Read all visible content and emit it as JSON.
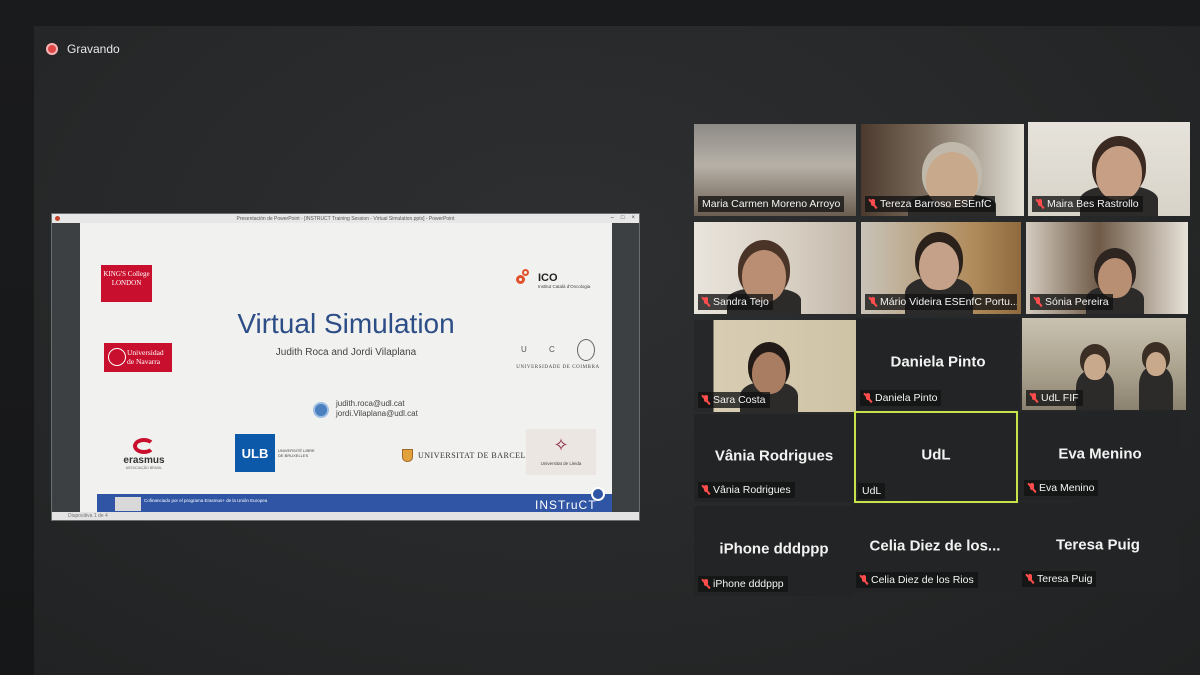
{
  "recording": {
    "label": "Gravando",
    "dot_color": "#e04848"
  },
  "shared_screen": {
    "window_title": "Presentación de PowerPoint - [INSTRUCT Training Session - Virtual Simulation.pptx] - PowerPoint",
    "window_controls": [
      "–",
      "□",
      "×"
    ],
    "status_text": "Diapositiva 1 de 4",
    "slide": {
      "title": "Virtual Simulation",
      "authors": "Judith Roca and Jordi Vilaplana",
      "emails": [
        "judith.roca@udl.cat",
        "jordi.Vilaplana@udl.cat"
      ],
      "logos": {
        "kings": "KING'S College LONDON",
        "navarra": "Universidad de Navarra",
        "ico": "ICO",
        "ico_sub": "Institut Català d'Oncologia",
        "coimbra_mark": "U C",
        "coimbra": "UNIVERSIDADE DE COIMBRA",
        "erasmus": "erasmus",
        "erasmus_sub": "ASSOCIAÇÃO BRASIL",
        "ulb": "ULB",
        "ulb_sub": "UNIVERSITÉ LIBRE DE BRUXELLES",
        "barcelona": "UNIVERSITAT DE BARCELONA",
        "lleida": "Universitat de Lleida"
      },
      "footer": {
        "cofinanced": "Cofinanciado por el programa Erasmus+ de la Unión Europea",
        "instruct": "INSTruCT"
      },
      "accent_color": "#2c4d86",
      "footer_color": "#2f55a4"
    }
  },
  "participants": [
    {
      "name": "Maria Carmen Moreno Arroyo",
      "video": true,
      "muted": false
    },
    {
      "name": "Tereza Barroso ESEnfC",
      "video": true,
      "muted": true
    },
    {
      "name": "Maira Bes Rastrollo",
      "video": true,
      "muted": true
    },
    {
      "name": "Sandra Tejo",
      "video": true,
      "muted": true
    },
    {
      "name": "Mário Videira ESEnfC Portu...",
      "video": true,
      "muted": true
    },
    {
      "name": "Sónia Pereira",
      "video": true,
      "muted": true
    },
    {
      "name": "Sara Costa",
      "video": true,
      "muted": true
    },
    {
      "name": "Daniela Pinto",
      "display": "Daniela Pinto",
      "video": false,
      "muted": true
    },
    {
      "name": "UdL FIF",
      "video": true,
      "muted": true
    },
    {
      "name": "Vânia Rodrigues",
      "display": "Vânia Rodrigues",
      "video": false,
      "muted": true
    },
    {
      "name": "UdL",
      "display": "UdL",
      "video": false,
      "muted": false,
      "active": true
    },
    {
      "name": "Eva Menino",
      "display": "Eva Menino",
      "video": false,
      "muted": true
    },
    {
      "name": "iPhone dddppp",
      "display": "iPhone dddppp",
      "video": false,
      "muted": true
    },
    {
      "name": "Celia Diez de los Rios",
      "display": "Celia Diez de los...",
      "video": false,
      "muted": true
    },
    {
      "name": "Teresa Puig",
      "display": "Teresa Puig",
      "video": false,
      "muted": true
    }
  ],
  "colors": {
    "active_speaker": "#c6e34a",
    "muted_icon": "#ff4d4d"
  }
}
